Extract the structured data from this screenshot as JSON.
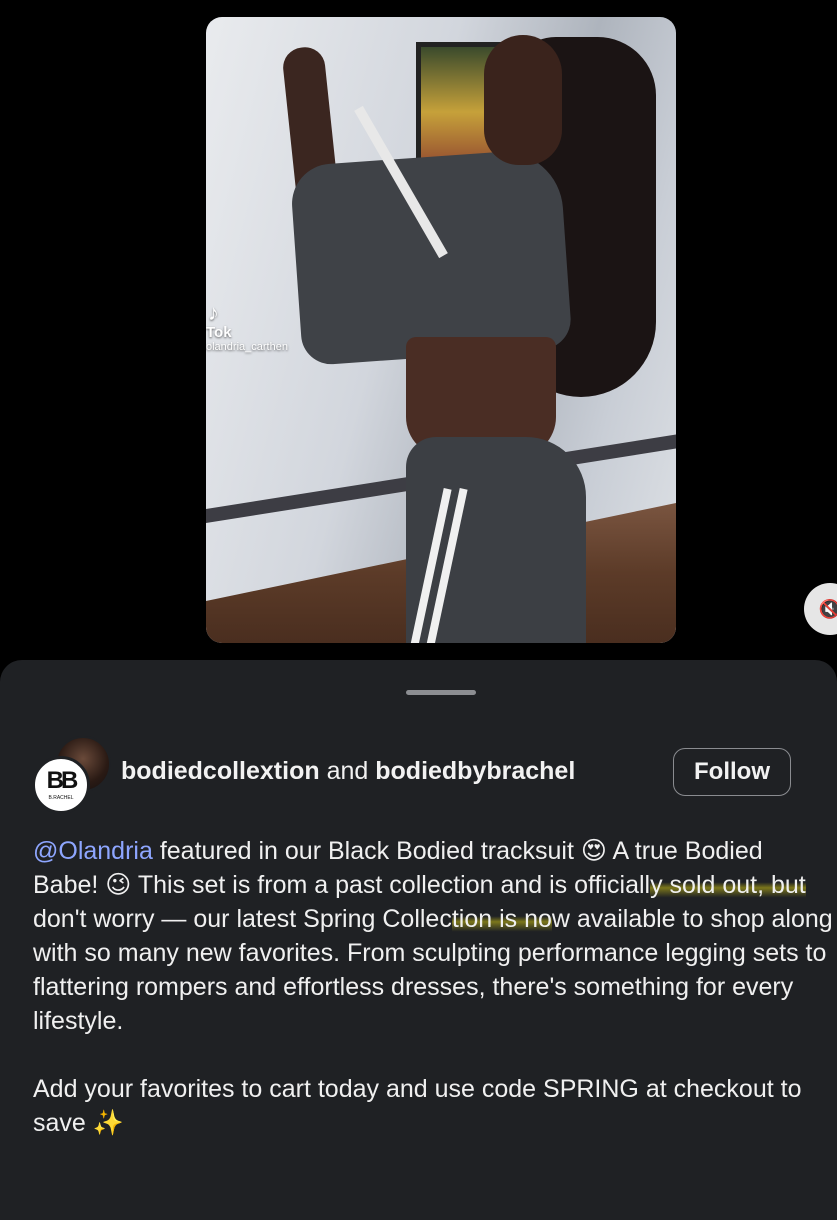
{
  "video": {
    "watermark_app": "Tok",
    "watermark_handle": "olandria_carthen",
    "mute_icon": "speaker-muted-icon"
  },
  "post": {
    "author_primary": "bodiedcollextion",
    "author_connector": "and",
    "author_secondary": "bodiedbybrachel",
    "avatar_monogram": "BB",
    "avatar_subtext": "B.RACHEL",
    "follow_label": "Follow",
    "caption": {
      "mention": "@Olandria",
      "part1": " featured in our Black Bodied tracksuit ",
      "emoji1": "😍",
      "part2": " A true Bodied Babe! ",
      "emoji2": "😉",
      "part3": " This set is from a past collection and is officiall",
      "highlight1": "y sold out, but",
      "part4": " don't worry — our latest Spring Collec",
      "highlight2": "tion is no",
      "part5": "w available to shop along with so many new favorites. From sculpting performance legging sets to flattering rompers and effortless dresses, there's something for every lifestyle.",
      "paragraph2": "Add your favorites to cart today and use code SPRING at checkout to save ",
      "emoji3": "✨"
    }
  }
}
